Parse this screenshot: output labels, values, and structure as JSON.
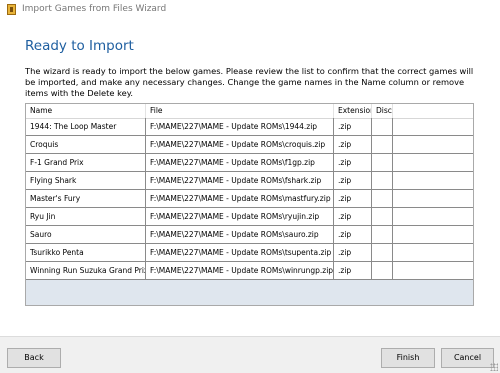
{
  "window": {
    "title": "Import Games from Files Wizard",
    "icon": "app-icon"
  },
  "page": {
    "heading": "Ready to Import",
    "description": "The wizard is ready to import the below games. Please review the list to confirm that the correct games will be imported, and make any necessary changes. Change the game names in the Name column or remove items with the Delete key."
  },
  "table": {
    "columns": [
      "Name",
      "File",
      "Extension",
      "Disc"
    ],
    "rows": [
      {
        "name": "1944: The Loop Master",
        "file": "F:\\MAME\\227\\MAME - Update ROMs\\1944.zip",
        "ext": ".zip",
        "disc": ""
      },
      {
        "name": "Croquis",
        "file": "F:\\MAME\\227\\MAME - Update ROMs\\croquis.zip",
        "ext": ".zip",
        "disc": ""
      },
      {
        "name": "F-1 Grand Prix",
        "file": "F:\\MAME\\227\\MAME - Update ROMs\\f1gp.zip",
        "ext": ".zip",
        "disc": ""
      },
      {
        "name": "Flying Shark",
        "file": "F:\\MAME\\227\\MAME - Update ROMs\\fshark.zip",
        "ext": ".zip",
        "disc": ""
      },
      {
        "name": "Master's Fury",
        "file": "F:\\MAME\\227\\MAME - Update ROMs\\mastfury.zip",
        "ext": ".zip",
        "disc": ""
      },
      {
        "name": "Ryu Jin",
        "file": "F:\\MAME\\227\\MAME - Update ROMs\\ryujin.zip",
        "ext": ".zip",
        "disc": ""
      },
      {
        "name": "Sauro",
        "file": "F:\\MAME\\227\\MAME - Update ROMs\\sauro.zip",
        "ext": ".zip",
        "disc": ""
      },
      {
        "name": "Tsurikko Penta",
        "file": "F:\\MAME\\227\\MAME - Update ROMs\\tsupenta.zip",
        "ext": ".zip",
        "disc": ""
      },
      {
        "name": "Winning Run Suzuka Grand Prix",
        "file": "F:\\MAME\\227\\MAME - Update ROMs\\winrungp.zip",
        "ext": ".zip",
        "disc": ""
      }
    ]
  },
  "buttons": {
    "back": "Back",
    "finish": "Finish",
    "cancel": "Cancel"
  },
  "colors": {
    "heading": "#1f5fa0",
    "empty_area": "#dfe6ee",
    "footer": "#f0f0f0"
  }
}
